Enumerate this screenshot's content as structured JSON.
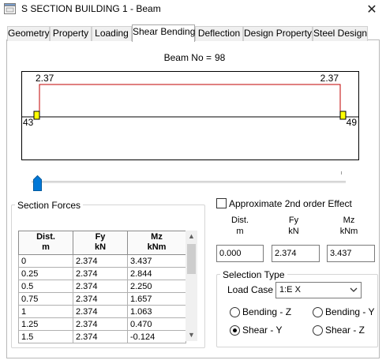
{
  "window": {
    "title": "S SECTION BUILDING 1 - Beam",
    "close_glyph": "✕"
  },
  "tabs": [
    {
      "label": "Geometry",
      "active": false
    },
    {
      "label": "Property",
      "active": false
    },
    {
      "label": "Loading",
      "active": false
    },
    {
      "label": "Shear Bending",
      "active": true
    },
    {
      "label": "Deflection",
      "active": false
    },
    {
      "label": "Design Property",
      "active": false
    },
    {
      "label": "Steel Design",
      "active": false
    }
  ],
  "beam": {
    "label": "Beam No =",
    "number": "98"
  },
  "diagram": {
    "left_value": "2.37",
    "right_value": "2.37",
    "start_node": "43",
    "end_node": "49",
    "shear_color": "#c00000",
    "support_color": "#ffff00"
  },
  "slider": {
    "position": 0.0
  },
  "section_forces": {
    "title": "Section Forces",
    "headers": [
      {
        "line1": "Dist.",
        "line2": "m"
      },
      {
        "line1": "Fy",
        "line2": "kN"
      },
      {
        "line1": "Mz",
        "line2": "kNm"
      }
    ],
    "rows": [
      [
        "0",
        "2.374",
        "3.437"
      ],
      [
        "0.25",
        "2.374",
        "2.844"
      ],
      [
        "0.5",
        "2.374",
        "2.250"
      ],
      [
        "0.75",
        "2.374",
        "1.657"
      ],
      [
        "1",
        "2.374",
        "1.063"
      ],
      [
        "1.25",
        "2.374",
        "0.470"
      ],
      [
        "1.5",
        "2.374",
        "-0.124"
      ]
    ]
  },
  "approx": {
    "label": "Approximate 2nd order Effect",
    "checked": false
  },
  "fields": [
    {
      "line1": "Dist.",
      "line2": "m",
      "value": "0.000"
    },
    {
      "line1": "Fy",
      "line2": "kN",
      "value": "2.374"
    },
    {
      "line1": "Mz",
      "line2": "kNm",
      "value": "3.437"
    }
  ],
  "selection_type": {
    "title": "Selection Type",
    "load_case_label": "Load Case :",
    "load_case_value": "1:E X",
    "options": [
      {
        "label": "Bending - Z",
        "checked": false
      },
      {
        "label": "Bending - Y",
        "checked": false
      },
      {
        "label": "Shear - Y",
        "checked": true
      },
      {
        "label": "Shear - Z",
        "checked": false
      }
    ]
  }
}
